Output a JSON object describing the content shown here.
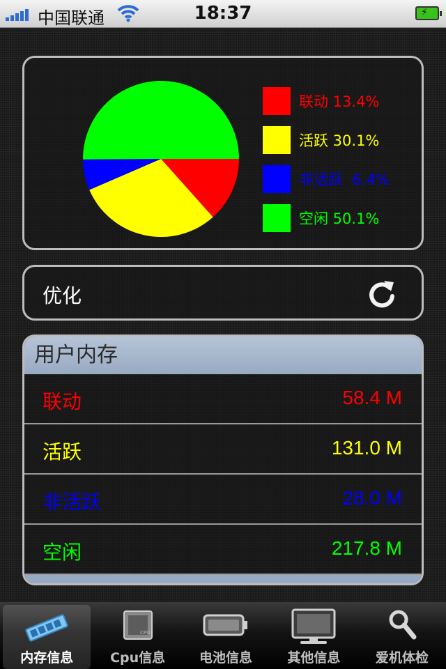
{
  "status_bar": {
    "carrier": "中国联通",
    "time": "18:37"
  },
  "chart_data": {
    "type": "pie",
    "slices": [
      {
        "label": "联动",
        "percent_label": "13.4%",
        "value": 13.4,
        "color": "#ff0000"
      },
      {
        "label": "活跃",
        "percent_label": "30.1%",
        "value": 30.1,
        "color": "#ffff00"
      },
      {
        "label": "非活跃",
        "percent_label": "6.4%",
        "value": 6.4,
        "color": "#0000ff"
      },
      {
        "label": "空闲",
        "percent_label": "50.1%",
        "value": 50.1,
        "color": "#00ff00"
      }
    ]
  },
  "legend": [
    {
      "text": "联动 13.4%",
      "color": "#ff0000"
    },
    {
      "text": "活跃 30.1%",
      "color": "#ffff00"
    },
    {
      "text": "非活跃  6.4%",
      "color": "#0000ff"
    },
    {
      "text": "空闲 50.1%",
      "color": "#00ff00"
    }
  ],
  "optimize": {
    "label": "优化",
    "icon": "refresh-icon"
  },
  "memory": {
    "title": "用户内存",
    "rows": [
      {
        "name": "联动",
        "value": "58.4 M",
        "color": "#ff0000"
      },
      {
        "name": "活跃",
        "value": "131.0 M",
        "color": "#ffff00"
      },
      {
        "name": "非活跃",
        "value": "28.0 M",
        "color": "#0000ff"
      },
      {
        "name": "空闲",
        "value": "217.8 M",
        "color": "#00ff00"
      }
    ]
  },
  "tabs": [
    {
      "label": "内存信息",
      "icon": "memory-chip-icon",
      "active": true
    },
    {
      "label": "Cpu信息",
      "icon": "cpu-icon",
      "active": false
    },
    {
      "label": "电池信息",
      "icon": "battery-icon",
      "active": false
    },
    {
      "label": "其他信息",
      "icon": "monitor-icon",
      "active": false
    },
    {
      "label": "爱机体检",
      "icon": "magnifier-icon",
      "active": false
    }
  ]
}
